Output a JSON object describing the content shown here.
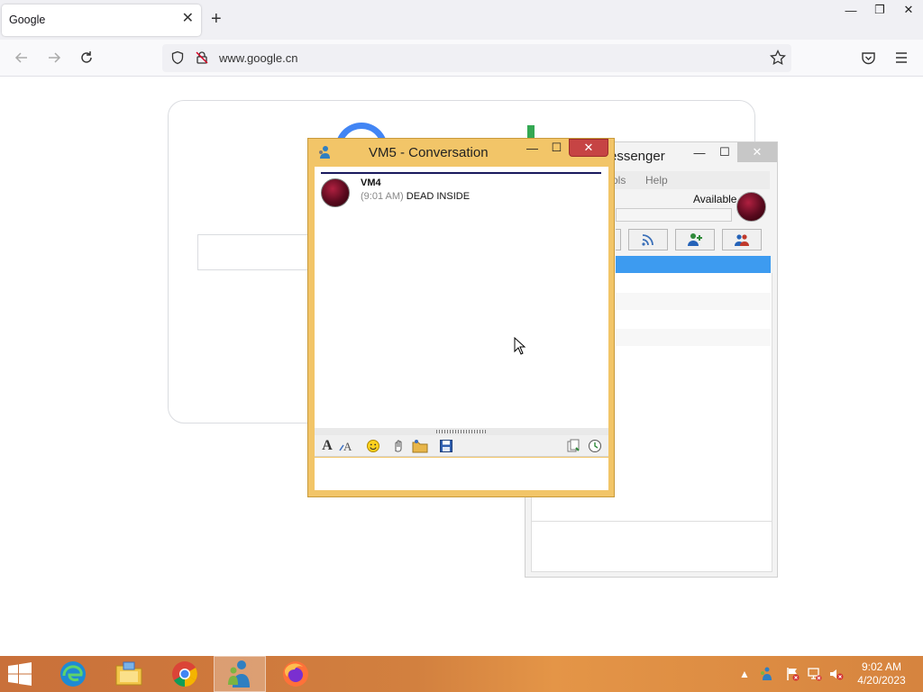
{
  "browser": {
    "tab_title": "Google",
    "tab_close": "✕",
    "new_tab": "+",
    "url": "www.google.cn",
    "window_minimize": "—",
    "window_restore": "❐",
    "window_close": "✕"
  },
  "messenger": {
    "title_partial": "essenger",
    "menu_tools_partial": "ols",
    "menu_help": "Help",
    "status": "Available"
  },
  "conversation": {
    "title": "VM5 - Conversation",
    "messages": [
      {
        "sender": "VM4",
        "time": "(9:01 AM)",
        "text": "DEAD INSIDE"
      }
    ]
  },
  "taskbar": {
    "time": "9:02 AM",
    "date": "4/20/2023"
  }
}
